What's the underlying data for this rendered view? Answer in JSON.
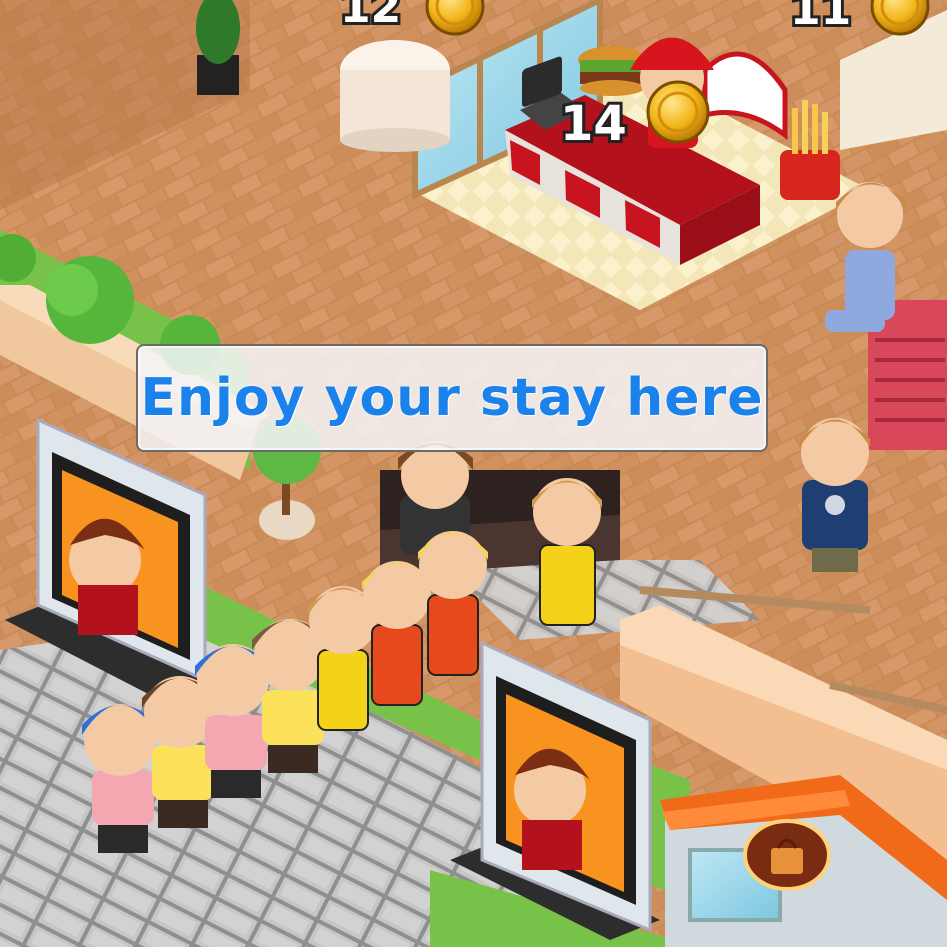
{
  "dialog": {
    "message": "Enjoy your stay here"
  },
  "counters": {
    "top_left": "12",
    "burger_stand": "14",
    "top_right": "11"
  },
  "icons": {
    "coin": "coin-icon",
    "shop_bag": "shopping-bag-icon"
  },
  "colors": {
    "dialog_text": "#1a82ea",
    "floor_wood": "#c98a55",
    "tile_stone": "#b9b9b9",
    "coin_gold": "#f2b41a",
    "shop_roof": "#f06a1a"
  }
}
